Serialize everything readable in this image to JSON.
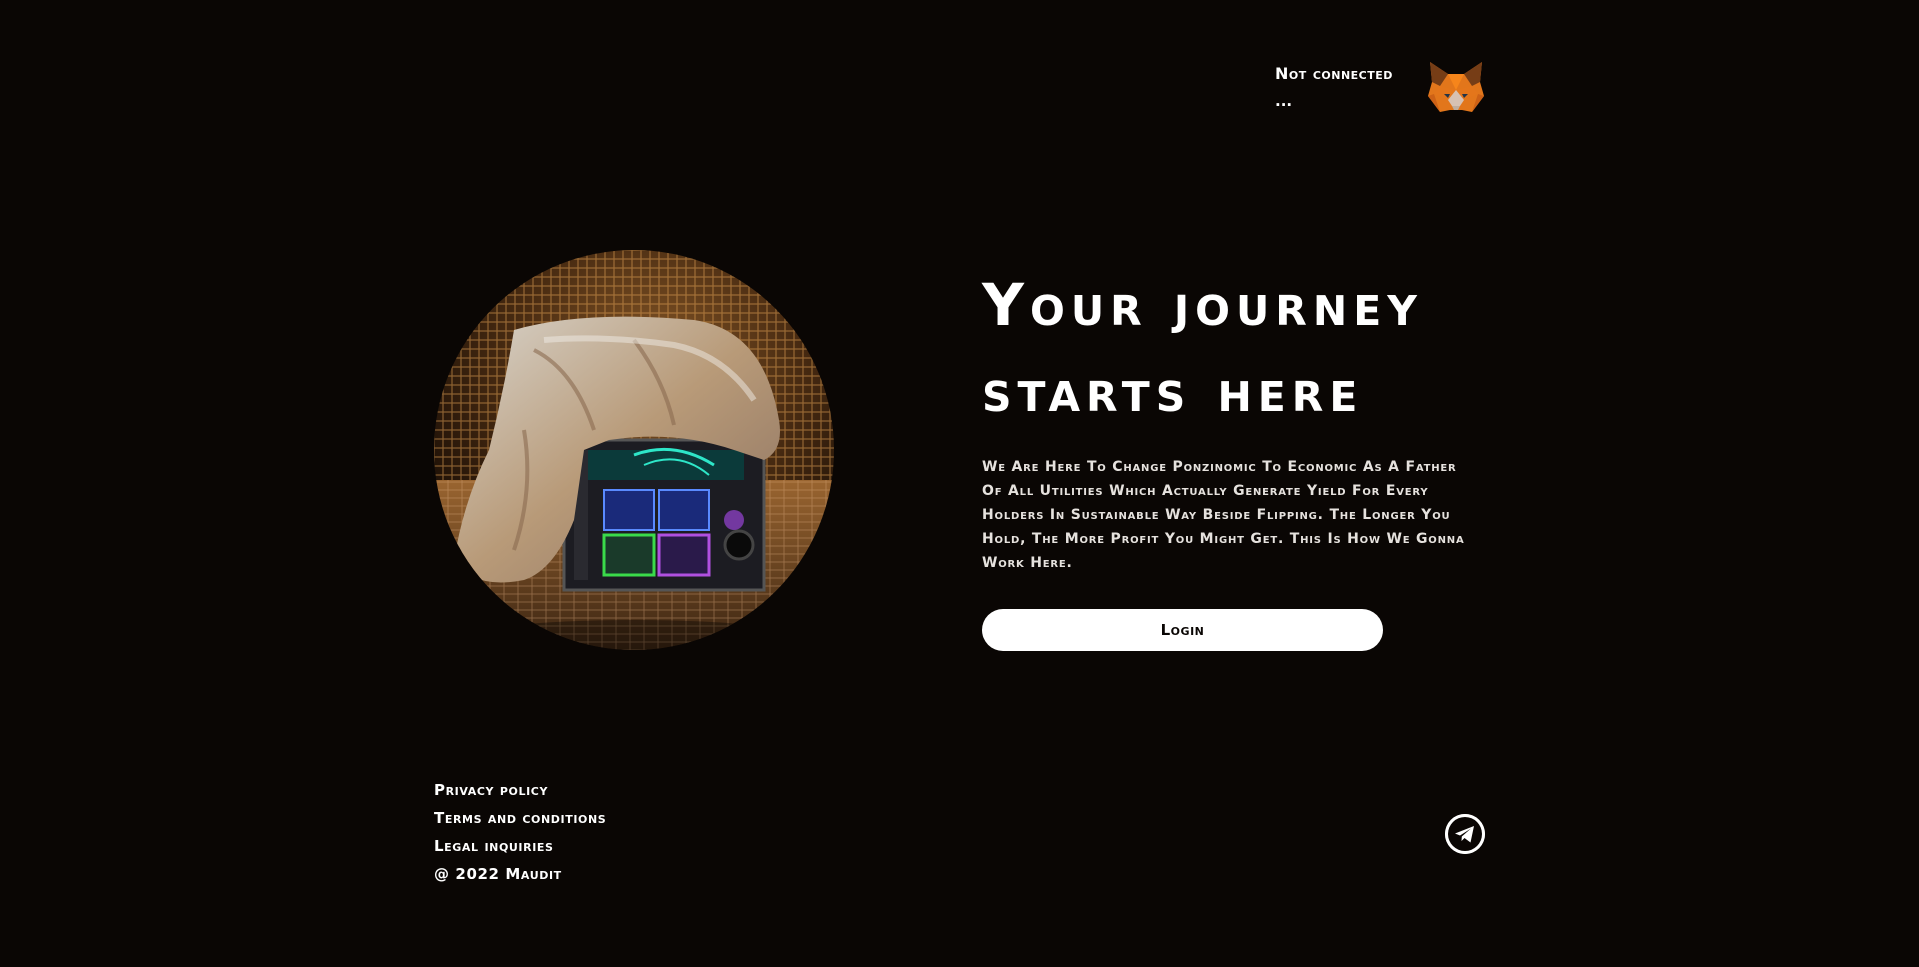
{
  "wallet": {
    "status": "Not connected",
    "address": "...",
    "icon": "metamask-fox-icon"
  },
  "hero": {
    "title_line1": "Your journey",
    "title_line2": "starts here",
    "description": "We Are Here To Change Ponzinomic To Economic As A Father Of All Utilities Which Actually Generate Yield For Every Holders In Sustainable Way Beside Flipping. The Longer You Hold, The More Profit You Might Get. This Is How We Gonna Work Here.",
    "login_label": "Login"
  },
  "footer": {
    "links": [
      "Privacy policy",
      "Terms and conditions",
      "Legal inquiries"
    ],
    "copyright": "@ 2022 Maudit",
    "social_icon": "telegram-icon"
  },
  "colors": {
    "background": "#0a0604",
    "text": "#ffffff",
    "button_bg": "#ffffff",
    "button_text": "#0a0604",
    "accent_orange": "#e2761b"
  }
}
